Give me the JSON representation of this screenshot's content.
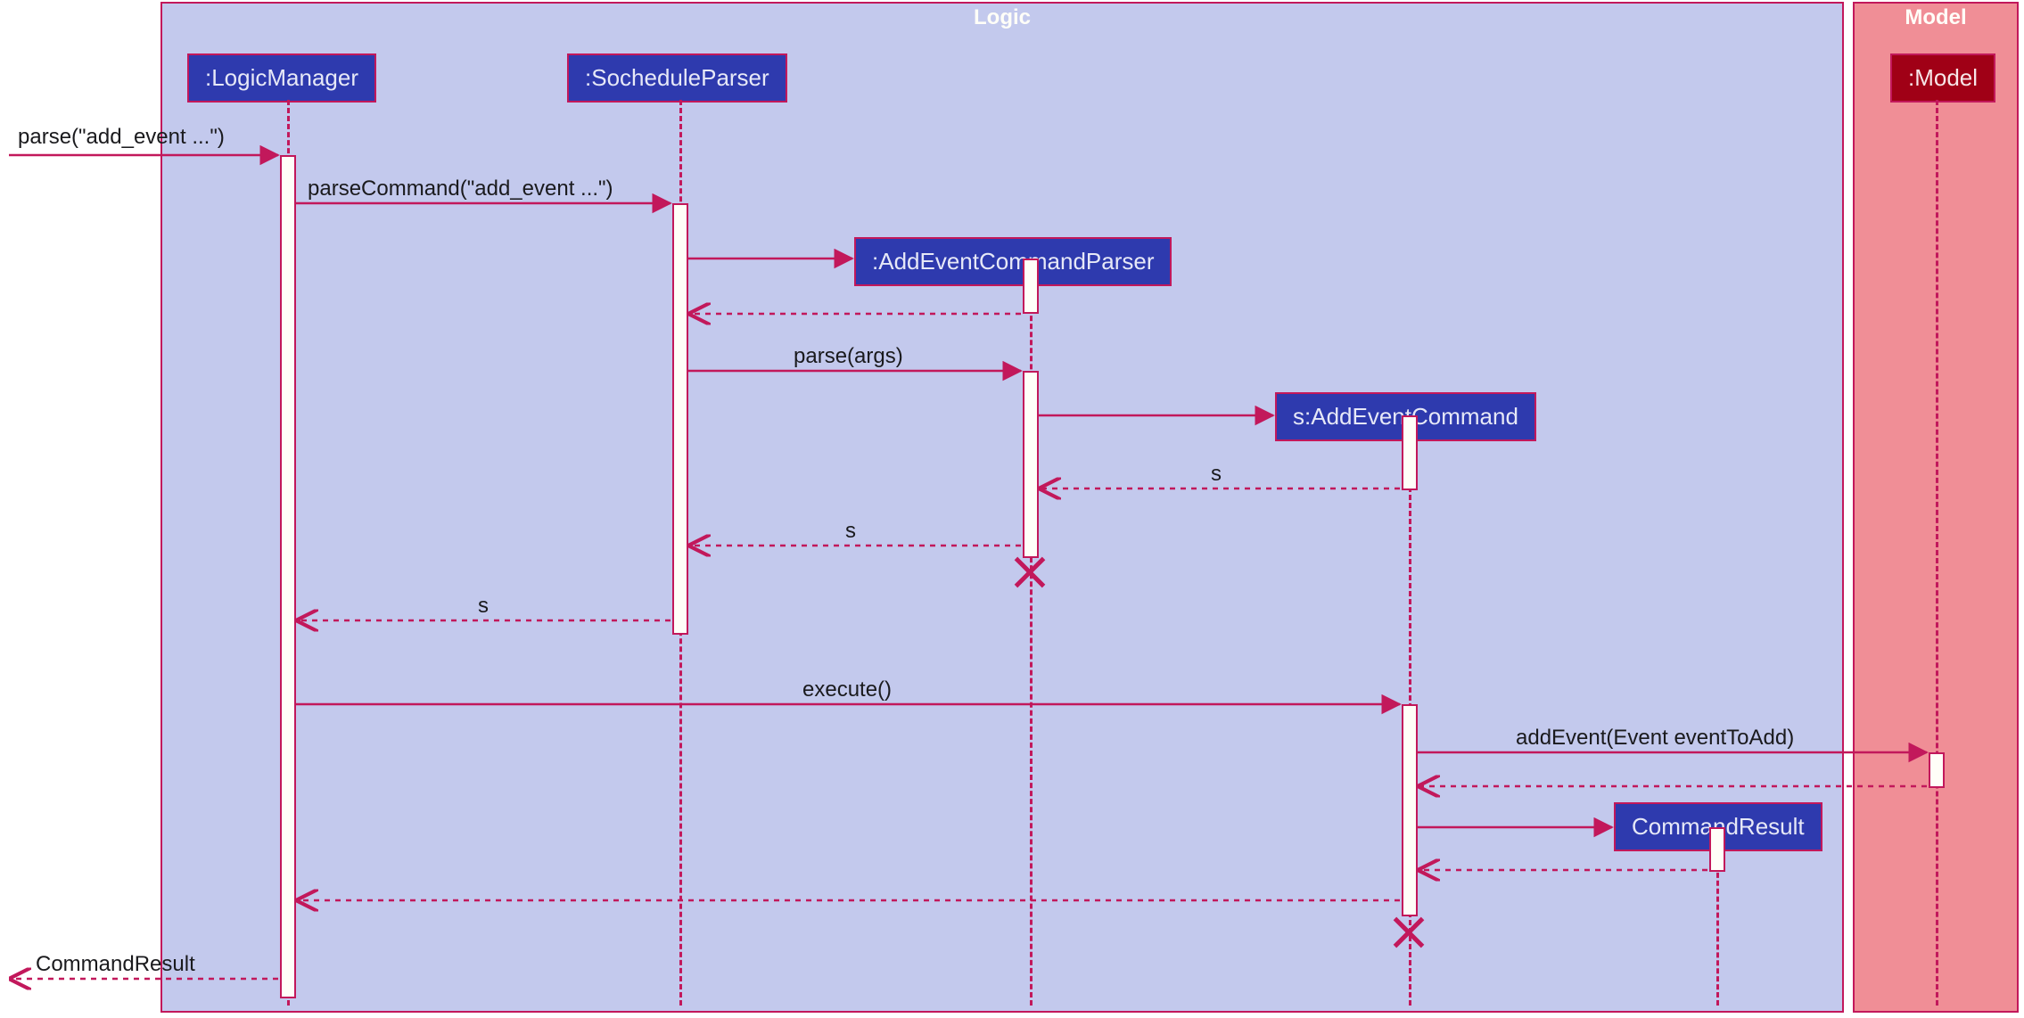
{
  "frames": {
    "logic": {
      "title": "Logic"
    },
    "model": {
      "title": "Model"
    }
  },
  "lifelines": {
    "logicManager": ":LogicManager",
    "socheduleParser": ":SocheduleParser",
    "addEventCommandParser": ":AddEventCommandParser",
    "addEventCommand": "s:AddEventCommand",
    "commandResult": "CommandResult",
    "model": ":Model"
  },
  "messages": {
    "m1": "parse(\"add_event ...\")",
    "m2": "parseCommand(\"add_event ...\")",
    "m3": "parse(args)",
    "m4": "s",
    "m5": "s",
    "m6": "s",
    "m7": "execute()",
    "m8": "addEvent(Event eventToAdd)",
    "m9": "CommandResult"
  },
  "colors": {
    "frameBorder": "#c2185b",
    "logicFill": "#c3c9ed",
    "modelFill": "#f08e96",
    "headFill": "#2e3aae",
    "modelHeadFill": "#a00016"
  }
}
